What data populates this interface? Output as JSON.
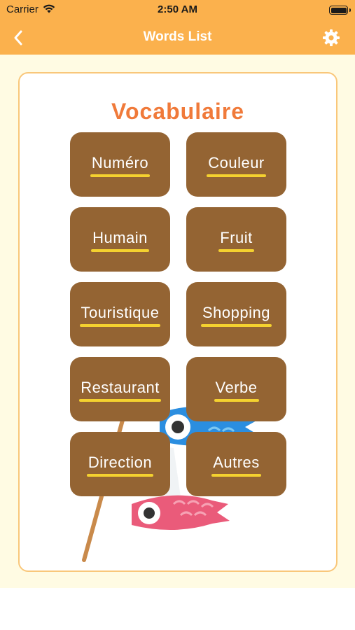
{
  "status_bar": {
    "carrier": "Carrier",
    "time": "2:50 AM"
  },
  "nav": {
    "title": "Words List",
    "back_icon": "chevron-left-icon",
    "settings_icon": "gear-icon"
  },
  "card": {
    "heading": "Vocabulaire"
  },
  "categories": [
    {
      "label": "Numéro"
    },
    {
      "label": "Couleur"
    },
    {
      "label": "Humain"
    },
    {
      "label": "Fruit"
    },
    {
      "label": "Touristique"
    },
    {
      "label": "Shopping"
    },
    {
      "label": "Restaurant"
    },
    {
      "label": "Verbe"
    },
    {
      "label": "Direction"
    },
    {
      "label": "Autres"
    }
  ],
  "colors": {
    "header": "#fbb14d",
    "background": "#fffbe3",
    "card_border": "#f9c77a",
    "heading": "#f07a3a",
    "tile": "#946433",
    "underline": "#f4d12f"
  }
}
